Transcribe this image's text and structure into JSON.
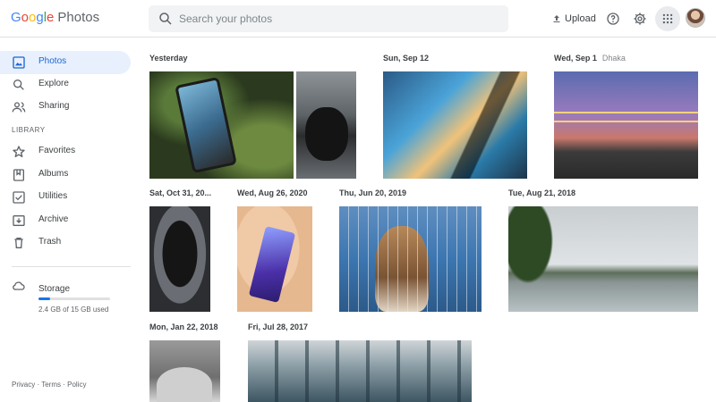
{
  "app": {
    "logo_google": "Google",
    "logo_photos": "Photos"
  },
  "search": {
    "placeholder": "Search your photos"
  },
  "header": {
    "upload_label": "Upload"
  },
  "sidebar": {
    "items": [
      {
        "label": "Photos",
        "icon": "photo-icon",
        "active": true
      },
      {
        "label": "Explore",
        "icon": "search-icon"
      },
      {
        "label": "Sharing",
        "icon": "people-icon"
      }
    ],
    "library_title": "LIBRARY",
    "library_items": [
      {
        "label": "Favorites",
        "icon": "star-icon"
      },
      {
        "label": "Albums",
        "icon": "bookmark-icon"
      },
      {
        "label": "Utilities",
        "icon": "checkbox-icon"
      },
      {
        "label": "Archive",
        "icon": "archive-icon"
      },
      {
        "label": "Trash",
        "icon": "trash-icon"
      }
    ],
    "storage": {
      "label": "Storage",
      "text": "2.4 GB of 15 GB used",
      "used_fraction": 0.16
    },
    "footer": {
      "privacy": "Privacy",
      "terms": "Terms",
      "policy": "Policy",
      "sep": "·"
    }
  },
  "groups": [
    {
      "date": "Yesterday",
      "location": ""
    },
    {
      "date": "Sun, Sep 12",
      "location": ""
    },
    {
      "date": "Wed, Sep 1",
      "location": "Dhaka"
    },
    {
      "date": "Sat, Oct 31, 20...",
      "location": ""
    },
    {
      "date": "Wed, Aug 26, 2020",
      "location": ""
    },
    {
      "date": "Thu, Jun 20, 2019",
      "location": ""
    },
    {
      "date": "Tue, Aug 21, 2018",
      "location": ""
    },
    {
      "date": "Mon, Jan 22, 2018",
      "location": ""
    },
    {
      "date": "Fri, Jul 28, 2017",
      "location": ""
    }
  ],
  "colors": {
    "accent": "#1a73e8",
    "active_bg": "#e8f0fe",
    "active_text": "#1967d2"
  }
}
